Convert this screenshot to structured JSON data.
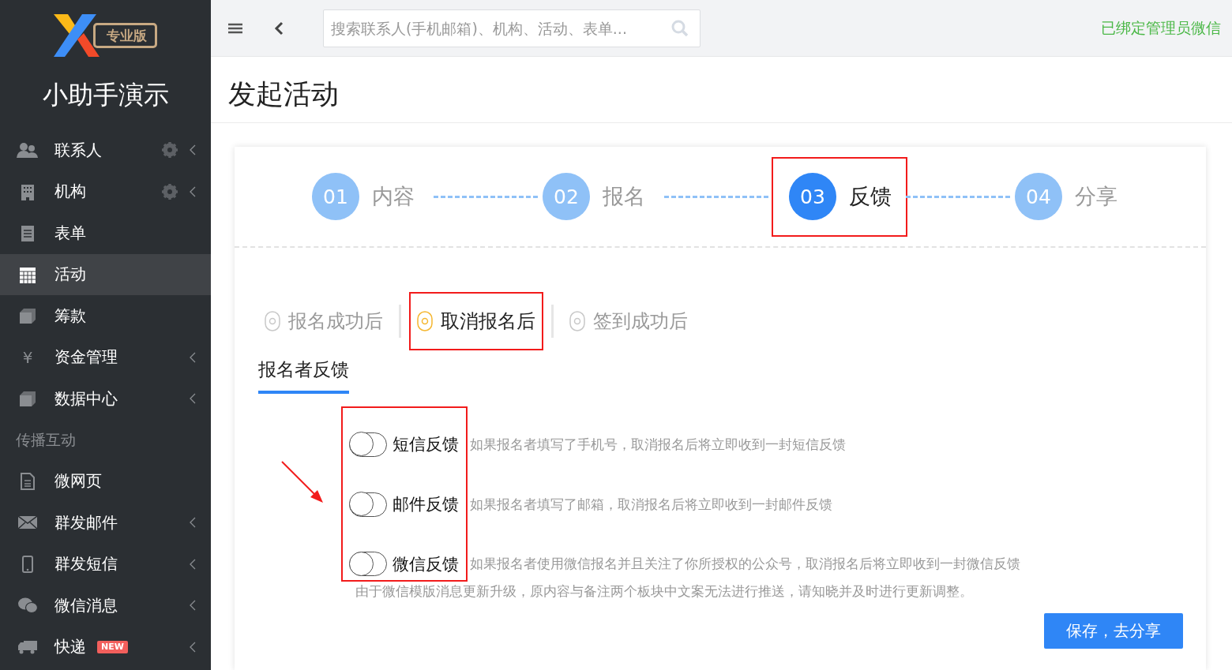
{
  "sidebar": {
    "logo_badge": "专业版",
    "org_name": "小助手演示",
    "items": [
      {
        "kind": "item",
        "label": "联系人",
        "gear": true,
        "chevron": true,
        "selected": false
      },
      {
        "kind": "item",
        "label": "机构",
        "gear": true,
        "chevron": true,
        "selected": false
      },
      {
        "kind": "item",
        "label": "表单",
        "gear": false,
        "chevron": false,
        "selected": false
      },
      {
        "kind": "item",
        "label": "活动",
        "gear": false,
        "chevron": false,
        "selected": true
      },
      {
        "kind": "item",
        "label": "筹款",
        "gear": false,
        "chevron": false,
        "selected": false
      },
      {
        "kind": "item",
        "label": "资金管理",
        "icon_text": "¥",
        "gear": false,
        "chevron": true,
        "selected": false
      },
      {
        "kind": "item",
        "label": "数据中心",
        "gear": false,
        "chevron": true,
        "selected": false
      },
      {
        "kind": "section",
        "label": "传播互动"
      },
      {
        "kind": "item",
        "label": "微网页",
        "gear": false,
        "chevron": false,
        "selected": false
      },
      {
        "kind": "item",
        "label": "群发邮件",
        "gear": false,
        "chevron": true,
        "selected": false
      },
      {
        "kind": "item",
        "label": "群发短信",
        "gear": false,
        "chevron": true,
        "selected": false
      },
      {
        "kind": "item",
        "label": "微信消息",
        "gear": false,
        "chevron": true,
        "selected": false
      },
      {
        "kind": "item",
        "label": "快递",
        "badge": "NEW",
        "gear": false,
        "chevron": true,
        "selected": false
      }
    ]
  },
  "topbar": {
    "search": {
      "placeholder": "搜索联系人(手机邮箱)、机构、活动、表单..."
    },
    "wechat_status": "已绑定管理员微信"
  },
  "page": {
    "title": "发起活动"
  },
  "steps": [
    {
      "number": "01",
      "label": "内容",
      "selected": false,
      "highlighted": false
    },
    {
      "number": "02",
      "label": "报名",
      "selected": false,
      "highlighted": false
    },
    {
      "number": "03",
      "label": "反馈",
      "selected": true,
      "highlighted": true
    },
    {
      "number": "04",
      "label": "分享",
      "selected": false,
      "highlighted": false
    }
  ],
  "subtabs": [
    {
      "label": "报名成功后",
      "selected": false,
      "highlighted": false
    },
    {
      "label": "取消报名后",
      "selected": true,
      "highlighted": true
    },
    {
      "label": "签到成功后",
      "selected": false,
      "highlighted": false
    }
  ],
  "section_title": "报名者反馈",
  "toggles_highlighted": true,
  "annotation_arrow": true,
  "toggles": [
    {
      "label": "短信反馈",
      "description": "如果报名者填写了手机号，取消报名后将立即收到一封短信反馈",
      "on": false
    },
    {
      "label": "邮件反馈",
      "description": "如果报名者填写了邮箱，取消报名后将立即收到一封邮件反馈",
      "on": false
    },
    {
      "label": "微信反馈",
      "description": "如果报名者使用微信报名并且关注了你所授权的公众号，取消报名后将立即收到一封微信反馈",
      "on": false
    }
  ],
  "note": "由于微信模版消息更新升级，原内容与备注两个板块中文案无法进行推送，请知晓并及时进行更新调整。",
  "save_button": "保存，去分享"
}
